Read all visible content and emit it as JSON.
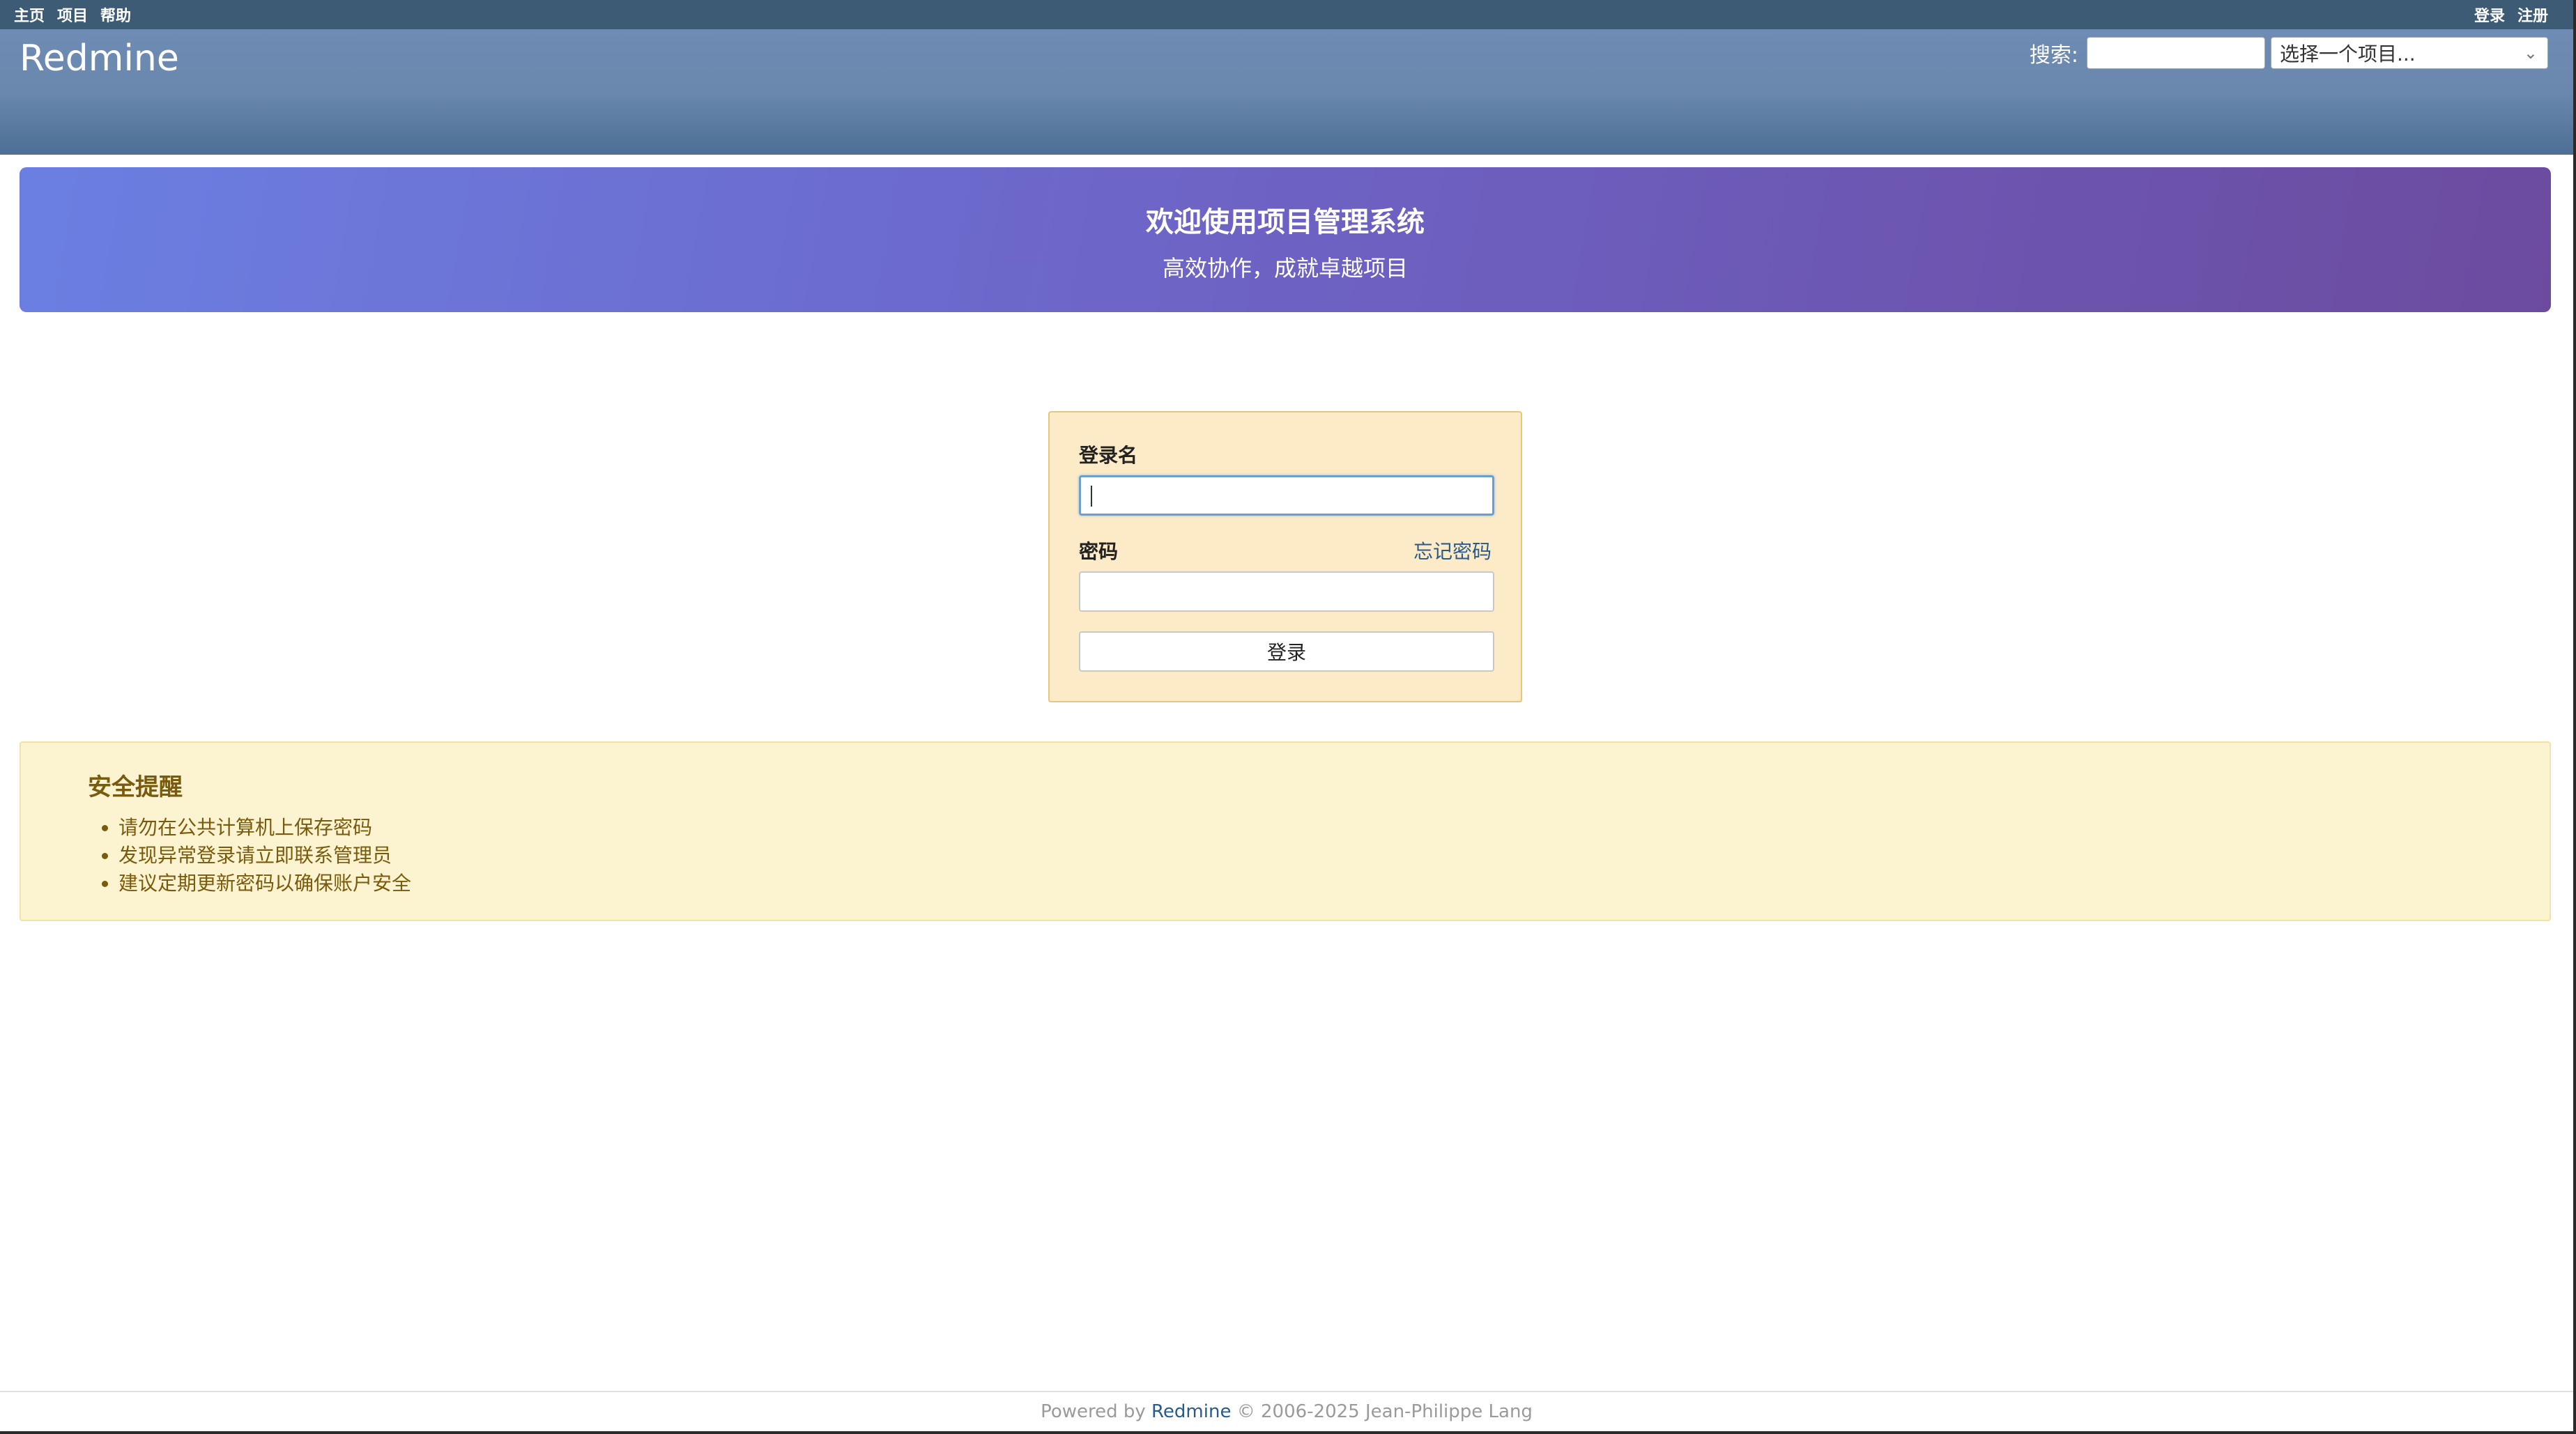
{
  "top_menu": {
    "left": [
      "主页",
      "项目",
      "帮助"
    ],
    "right": [
      "登录",
      "注册"
    ]
  },
  "header": {
    "site_title": "Redmine",
    "search_label": "搜索:",
    "search_value": "",
    "project_select": "选择一个项目..."
  },
  "welcome": {
    "title": "欢迎使用项目管理系统",
    "subtitle": "高效协作，成就卓越项目"
  },
  "login": {
    "username_label": "登录名",
    "username_value": "",
    "password_label": "密码",
    "forgot_link": "忘记密码",
    "password_value": "",
    "submit_label": "登录"
  },
  "notice": {
    "title": "安全提醒",
    "items": [
      "请勿在公共计算机上保存密码",
      "发现异常登录请立即联系管理员",
      "建议定期更新密码以确保账户安全"
    ]
  },
  "footer": {
    "prefix": "Powered by ",
    "link": "Redmine",
    "suffix": " © 2006-2025 Jean-Philippe Lang"
  }
}
